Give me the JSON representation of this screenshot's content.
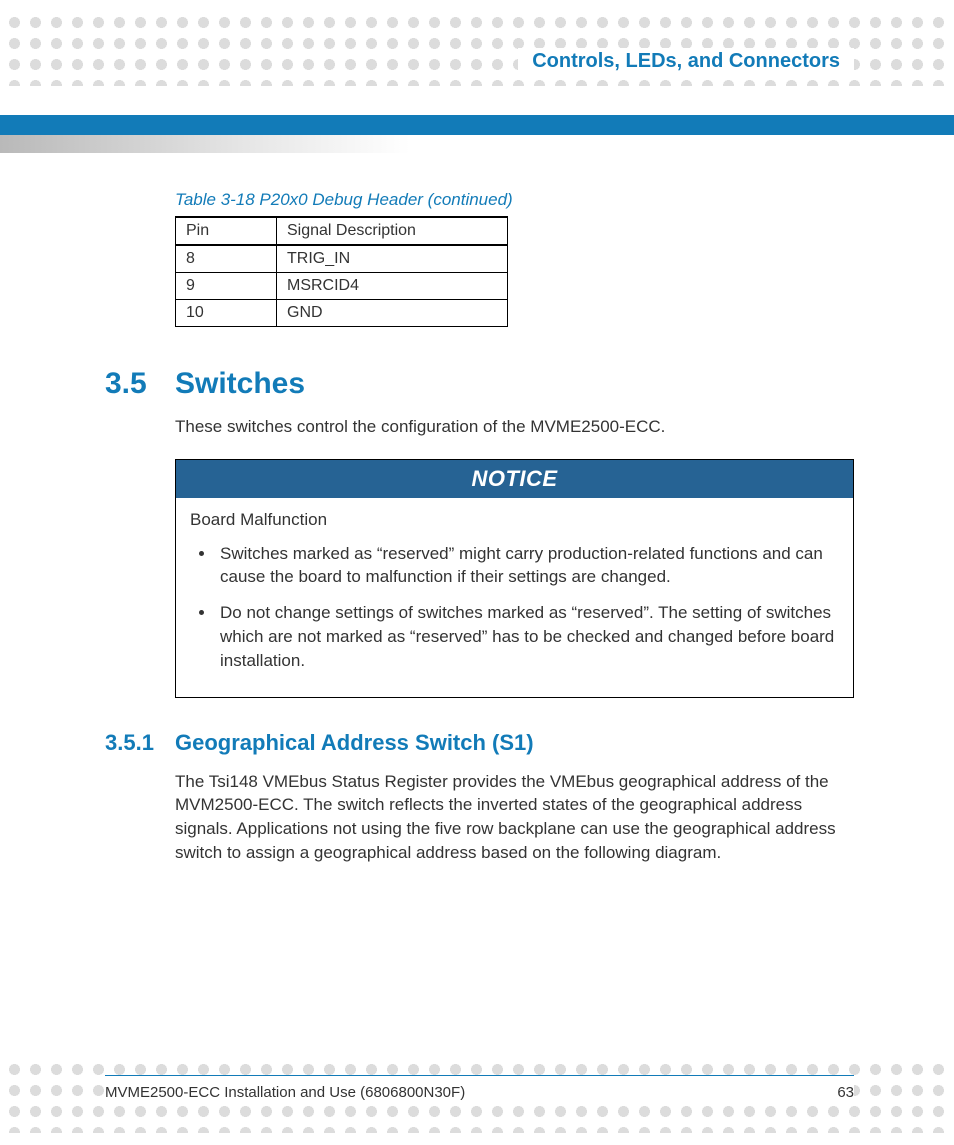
{
  "header": {
    "chapter_title": "Controls, LEDs, and Connectors"
  },
  "table": {
    "caption": "Table 3-18 P20x0 Debug Header  (continued)",
    "header": {
      "c1": "Pin",
      "c2": "Signal Description"
    },
    "rows": [
      {
        "c1": "8",
        "c2": "TRIG_IN"
      },
      {
        "c1": "9",
        "c2": "MSRCID4"
      },
      {
        "c1": "10",
        "c2": "GND"
      }
    ]
  },
  "section": {
    "number": "3.5",
    "title": "Switches",
    "intro": "These switches control the configuration of the MVME2500-ECC."
  },
  "notice": {
    "label": "NOTICE",
    "subtitle": "Board Malfunction",
    "items": [
      "Switches marked as “reserved” might carry production-related functions and can cause the board to malfunction if their settings are changed.",
      "Do not change settings of switches marked as “reserved”. The setting of switches which are not marked as “reserved” has to be checked and changed before board installation."
    ]
  },
  "subsection": {
    "number": "3.5.1",
    "title": "Geographical Address Switch (S1)",
    "body": "The Tsi148 VMEbus Status Register provides the VMEbus geographical address of the MVM2500-ECC. The switch reflects the inverted states of the geographical address signals. Applications not using the five row backplane can use the geographical address switch to assign a geographical address based on the following diagram."
  },
  "footer": {
    "doc": "MVME2500-ECC Installation and Use (6806800N30F)",
    "page": "63"
  }
}
